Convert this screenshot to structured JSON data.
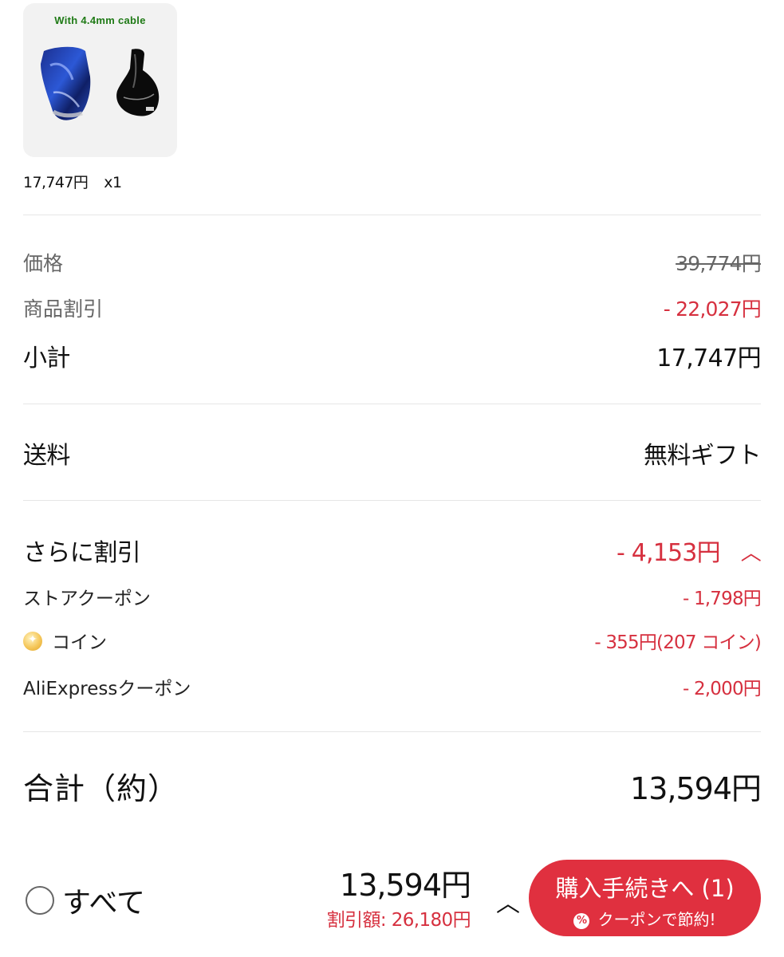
{
  "product": {
    "image_caption": "With 4.4mm cable",
    "price": "17,747円",
    "quantity": "x1"
  },
  "summary": {
    "price_label": "価格",
    "price_original": "39,774円",
    "product_discount_label": "商品割引",
    "product_discount_value": "- 22,027円",
    "subtotal_label": "小計",
    "subtotal_value": "17,747円"
  },
  "shipping": {
    "label": "送料",
    "value": "無料ギフト"
  },
  "extra_discount": {
    "label": "さらに割引",
    "value": "- 4,153円",
    "items": [
      {
        "label": "ストアクーポン",
        "value": "- 1,798円"
      },
      {
        "label": "コイン",
        "value": "- 355円(207 コイン)",
        "icon": "coin-icon"
      },
      {
        "label": "AliExpressクーポン",
        "value": "- 2,000円"
      }
    ]
  },
  "total": {
    "label": "合計（約）",
    "value": "13,594円"
  },
  "footer": {
    "select_all_label": "すべて",
    "total_value": "13,594円",
    "discount_text": "割引額: 26,180円",
    "checkout_label": "購入手続きへ (1)",
    "checkout_sub": "クーポンで節約!"
  },
  "colors": {
    "accent_red": "#e0303f",
    "discount_red": "#d6303f",
    "caption_green": "#1f7a16"
  }
}
